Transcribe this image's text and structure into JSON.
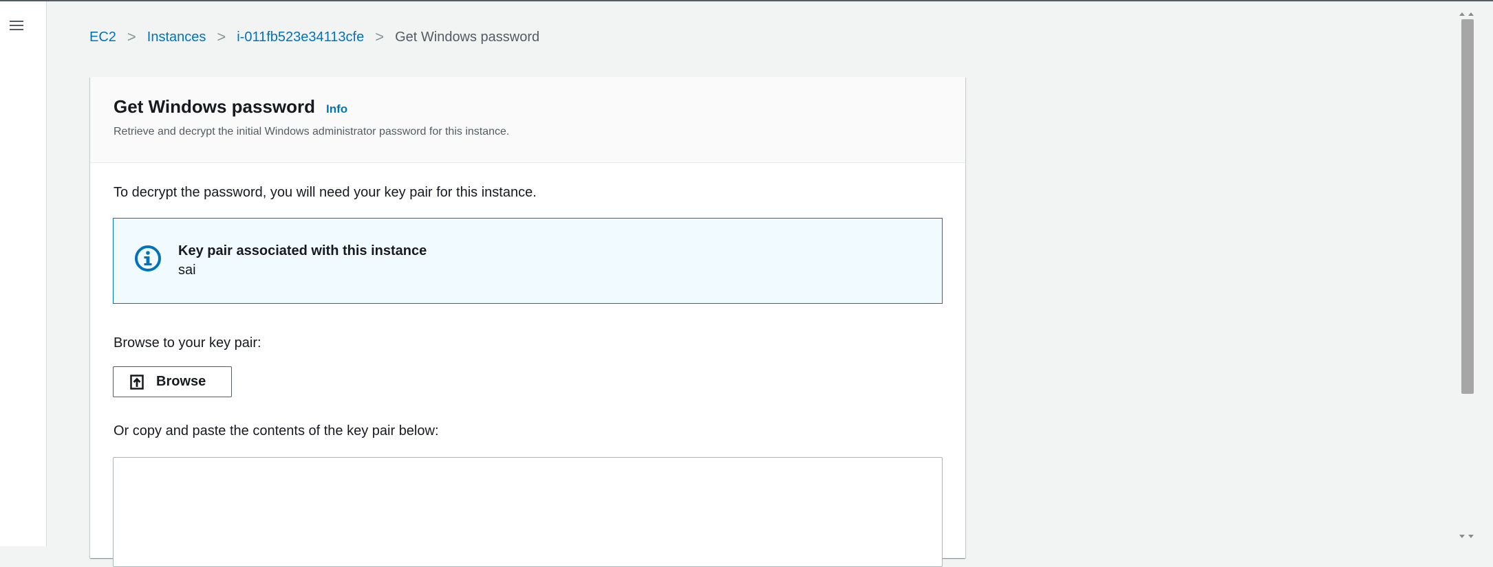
{
  "breadcrumb": {
    "items": [
      "EC2",
      "Instances",
      "i-011fb523e34113cfe"
    ],
    "current": "Get Windows password",
    "separator": ">"
  },
  "panel": {
    "title": "Get Windows password",
    "info_label": "Info",
    "description": "Retrieve and decrypt the initial Windows administrator password for this instance."
  },
  "body": {
    "intro": "To decrypt the password, you will need your key pair for this instance.",
    "alert": {
      "title": "Key pair associated with this instance",
      "value": "sai"
    },
    "browse_label": "Browse to your key pair:",
    "browse_button": "Browse",
    "paste_label": "Or copy and paste the contents of the key pair below:",
    "paste_value": ""
  },
  "colors": {
    "link": "#0073bb",
    "alert_bg": "#f1faff",
    "alert_border": "#0073bb"
  },
  "icons": {
    "menu": "hamburger-menu-icon",
    "info": "info-circle-icon",
    "upload": "upload-icon"
  }
}
